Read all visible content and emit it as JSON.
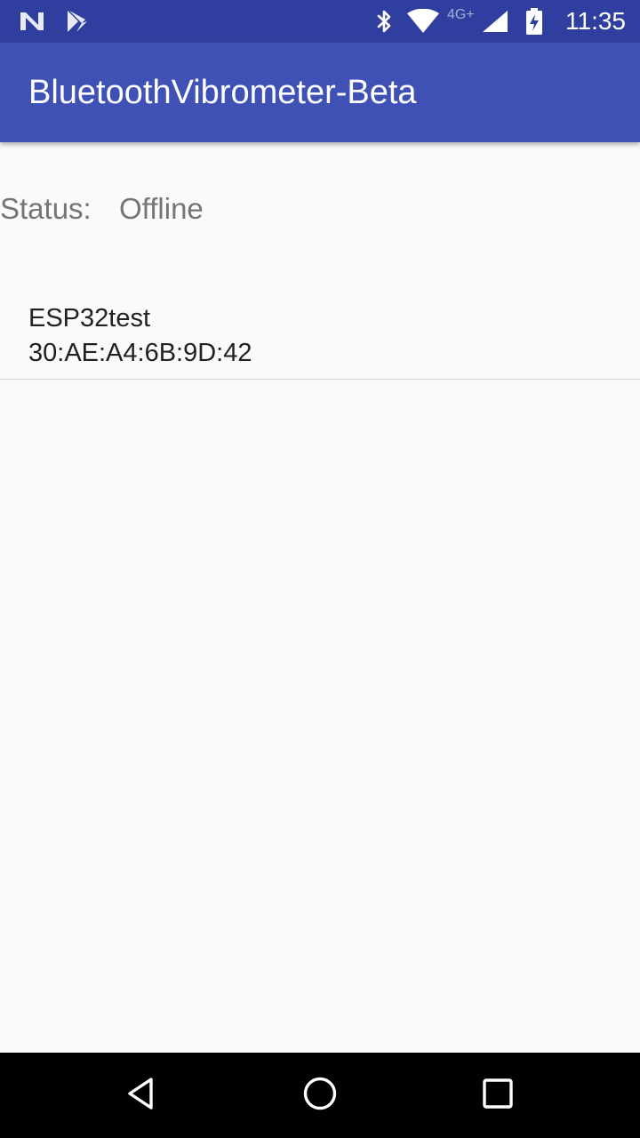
{
  "status_bar": {
    "time": "11:35",
    "network_type": "4G+",
    "icons": [
      "n-notification-icon",
      "play-store-download-icon",
      "bluetooth-icon",
      "wifi-icon",
      "cell-signal-icon",
      "battery-charging-icon"
    ]
  },
  "app_bar": {
    "title": "BluetoothVibrometer-Beta",
    "color": "#3f51b5",
    "status_bar_color": "#303f9f"
  },
  "main": {
    "status_label": "Status:",
    "status_value": "Offline",
    "devices": [
      {
        "name": "ESP32test",
        "address": "30:AE:A4:6B:9D:42"
      }
    ]
  },
  "nav_bar": {
    "buttons": [
      "back-icon",
      "home-icon",
      "recents-icon"
    ]
  }
}
